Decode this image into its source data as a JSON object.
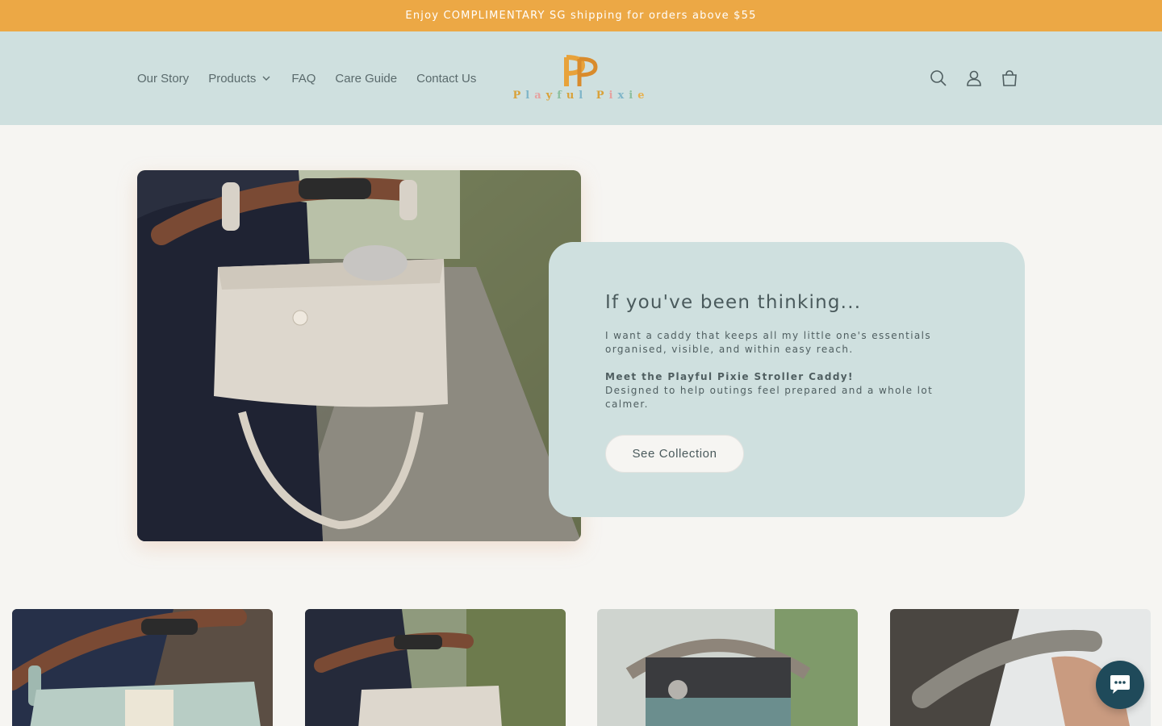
{
  "announcement": "Enjoy COMPLIMENTARY SG shipping for orders above $55",
  "nav": {
    "our_story": "Our Story",
    "products": "Products",
    "faq": "FAQ",
    "care_guide": "Care Guide",
    "contact_us": "Contact Us"
  },
  "logo": {
    "monogram": "PP",
    "letters": [
      "P",
      "l",
      "a",
      "y",
      "f",
      "u",
      "l",
      " ",
      "P",
      "i",
      "x",
      "i",
      "e"
    ],
    "letter_colors": [
      "#d9a23a",
      "#7fb5c9",
      "#e6a2a0",
      "#d9a23a",
      "#8bbf9f",
      "#d9a23a",
      "#7fb5c9",
      "",
      "#d9a23a",
      "#e6a2a0",
      "#7fb5c9",
      "#8bbf9f",
      "#e8b04c"
    ]
  },
  "header_icons": [
    "search-icon",
    "account-icon",
    "cart-icon"
  ],
  "hero": {
    "heading": "If you've been thinking...",
    "text_1": "I want a caddy that keeps all my little one's essentials organised, visible, and within easy reach.",
    "text_2": "Meet the Playful Pixie Stroller Caddy!",
    "text_3": "Designed to help outings feel prepared and a whole lot calmer.",
    "cta": "See Collection"
  },
  "colors": {
    "announcement_bg": "#eca845",
    "header_bg": "#cfe0df",
    "page_bg": "#f6f5f2",
    "chat_button": "#1f4a5a"
  }
}
